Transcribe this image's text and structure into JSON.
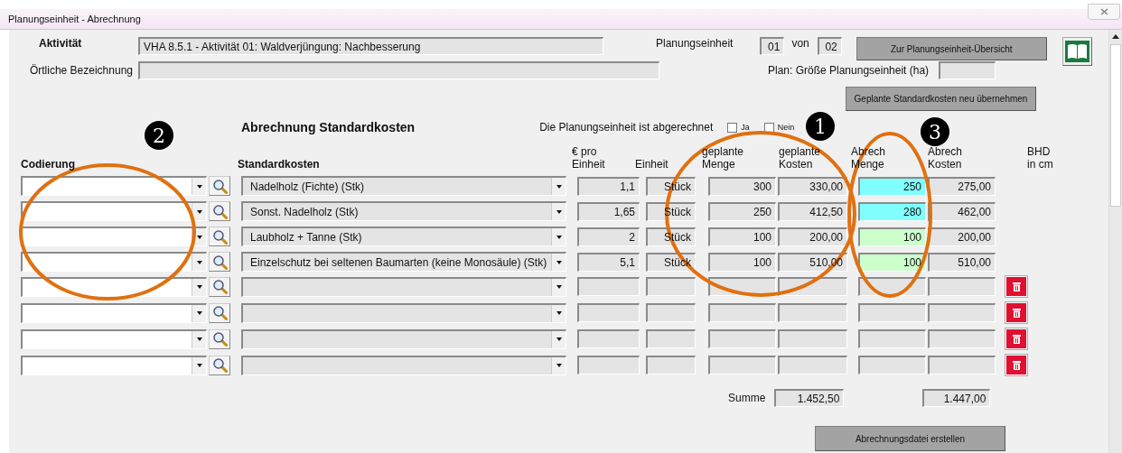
{
  "window": {
    "title": "Planungseinheit - Abrechnung"
  },
  "header": {
    "activity_label": "Aktivität",
    "activity_value": "VHA 8.5.1 - Aktivität 01: Waldverjüngung: Nachbesserung",
    "unit_label": "Planungseinheit",
    "unit_current": "01",
    "unit_of": "von",
    "unit_total": "02",
    "overview_button": "Zur Planungseinheit-Übersicht",
    "location_label": "Örtliche Bezeichnung",
    "area_label": "Plan: Größe Planungseinheit (ha)",
    "reload_button": "Geplante Standardkosten neu übernehmen"
  },
  "section": {
    "title": "Abrechnung Standardkosten",
    "settled_label": "Die Planungseinheit  ist abgerechnet",
    "options": [
      {
        "label": "Ja",
        "checked": false
      },
      {
        "label": "Nein",
        "checked": false
      }
    ]
  },
  "columns": [
    {
      "lines": [
        "Codierung"
      ],
      "bold": true
    },
    {
      "lines": [
        "Standardkosten"
      ],
      "bold": true
    },
    {
      "lines": [
        "€ pro",
        "Einheit"
      ],
      "bold": false
    },
    {
      "lines": [
        "Einheit"
      ],
      "bold": false
    },
    {
      "lines": [
        "geplante",
        "Menge"
      ],
      "bold": false
    },
    {
      "lines": [
        "geplante",
        "Kosten"
      ],
      "bold": false
    },
    {
      "lines": [
        "Abrech",
        "Menge"
      ],
      "bold": false
    },
    {
      "lines": [
        "Abrech",
        "Kosten"
      ],
      "bold": false
    },
    {
      "lines": [
        "BHD",
        "in cm"
      ],
      "bold": false
    }
  ],
  "rows": [
    {
      "standard": "Nadelholz (Fichte) (Stk)",
      "price": "1,1",
      "unit": "Stück",
      "planned_qty": "300",
      "planned_cost": "330,00",
      "actual_qty": "250",
      "actual_cost": "275,00",
      "color": "#80ffff",
      "deletable": false
    },
    {
      "standard": "Sonst. Nadelholz (Stk)",
      "price": "1,65",
      "unit": "Stück",
      "planned_qty": "250",
      "planned_cost": "412,50",
      "actual_qty": "280",
      "actual_cost": "462,00",
      "color": "#80ffff",
      "deletable": false
    },
    {
      "standard": "Laubholz + Tanne (Stk)",
      "price": "2",
      "unit": "Stück",
      "planned_qty": "100",
      "planned_cost": "200,00",
      "actual_qty": "100",
      "actual_cost": "200,00",
      "color": "#ccffcc",
      "deletable": false
    },
    {
      "standard": "Einzelschutz bei seltenen Baumarten (keine Monosäule) (Stk)",
      "price": "5,1",
      "unit": "Stück",
      "planned_qty": "100",
      "planned_cost": "510,00",
      "actual_qty": "100",
      "actual_cost": "510,00",
      "color": "#ccffcc",
      "deletable": false
    },
    {
      "deletable": true
    },
    {
      "deletable": true
    },
    {
      "deletable": true
    },
    {
      "deletable": true
    }
  ],
  "summary": {
    "label": "Summe",
    "planned_total": "1.452,50",
    "actual_total": "1.447,00"
  },
  "export_button": "Abrechnungsdatei erstellen",
  "annotations": [
    {
      "number": "1"
    },
    {
      "number": "2"
    },
    {
      "number": "3"
    }
  ]
}
